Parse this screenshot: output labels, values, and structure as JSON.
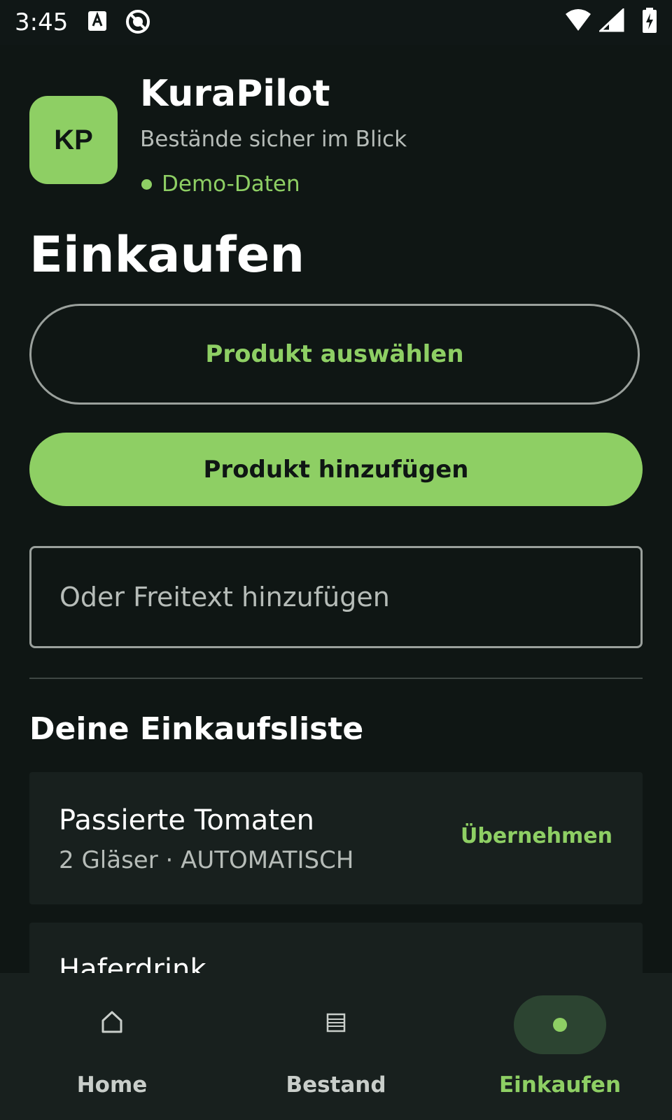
{
  "status_bar": {
    "time": "3:45",
    "icons": [
      "text-input-icon",
      "do-not-disturb-icon",
      "wifi-icon",
      "cellular-signal-icon",
      "battery-charging-icon"
    ]
  },
  "header": {
    "logo_text": "KP",
    "app_title": "KuraPilot",
    "subtitle": "Bestände sicher im Blick",
    "demo_badge": "Demo-Daten"
  },
  "main": {
    "page_title": "Einkaufen",
    "select_product_label": "Produkt auswählen",
    "add_product_label": "Produkt hinzufügen",
    "freitext": {
      "placeholder": "Oder Freitext hinzufügen",
      "value": ""
    },
    "list_title": "Deine Einkaufsliste",
    "items": [
      {
        "name": "Passierte Tomaten",
        "meta": "2 Gläser · AUTOMATISCH",
        "action": "Übernehmen"
      },
      {
        "name": "Haferdrink"
      }
    ]
  },
  "bottom_nav": {
    "items": [
      {
        "label": "Home",
        "icon": "home-icon"
      },
      {
        "label": "Bestand",
        "icon": "list-icon"
      },
      {
        "label": "Einkaufen",
        "icon": "dot-icon"
      }
    ],
    "active": "Einkaufen"
  },
  "colors": {
    "background": "#0f1614",
    "accent": "#8ecf64",
    "card": "#18201e",
    "active_nav_bg": "#2c4431"
  }
}
